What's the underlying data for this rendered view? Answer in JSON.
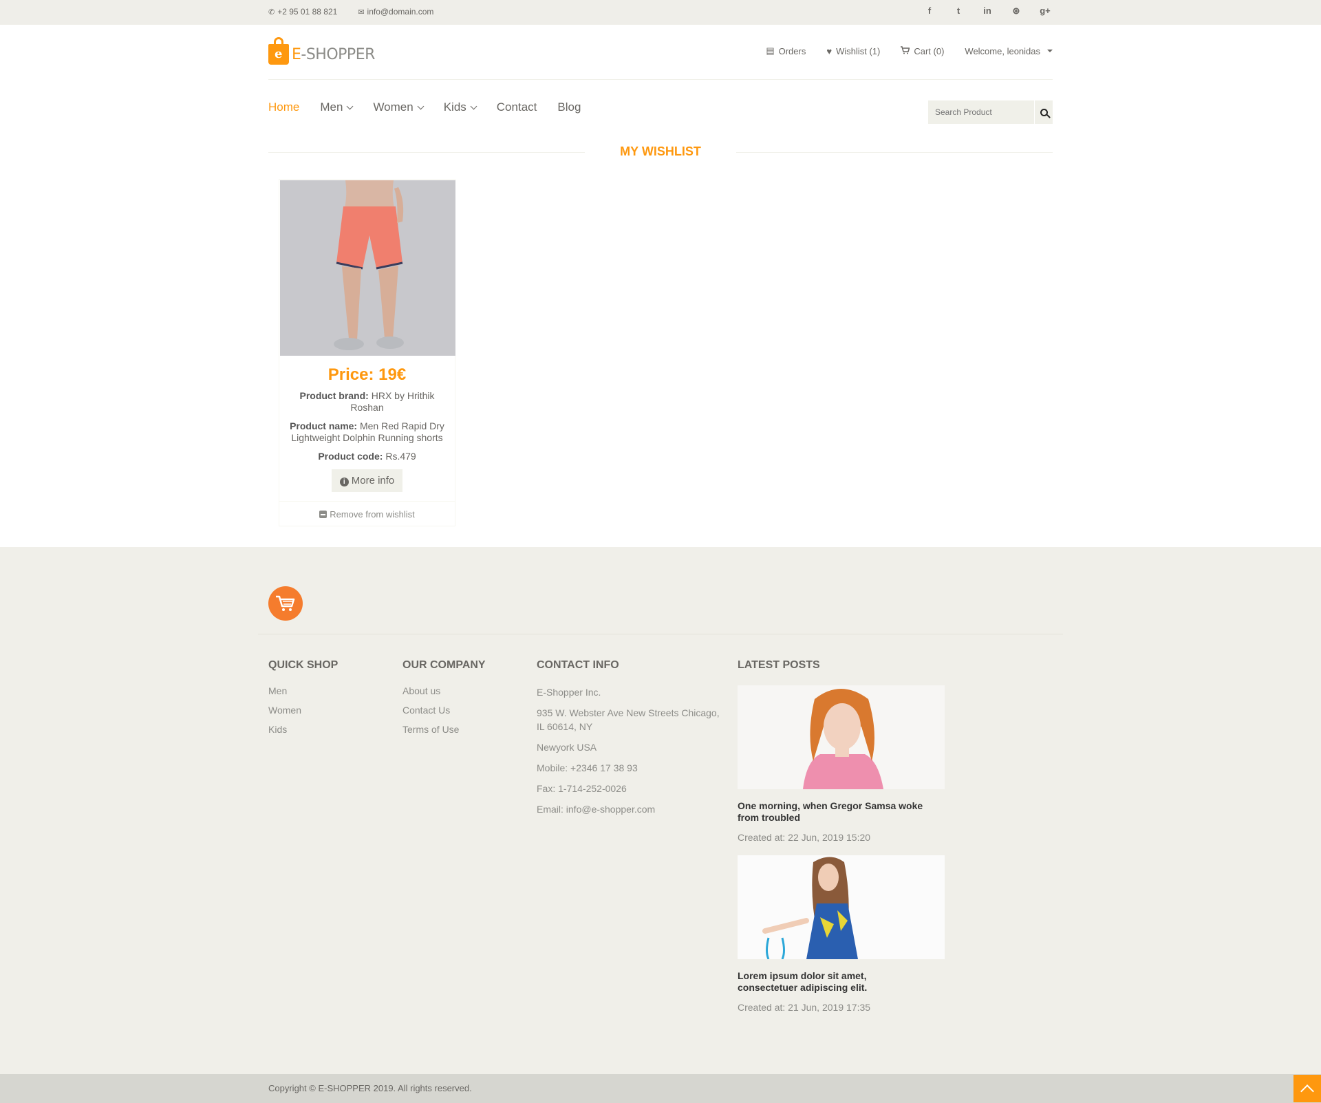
{
  "topbar": {
    "phone": "+2 95 01 88 821",
    "email": "info@domain.com",
    "social": [
      "f",
      "t",
      "in",
      "⊛",
      "g+"
    ]
  },
  "logo": {
    "prefix": "E",
    "text": "-SHOPPER",
    "bag_letter": "e"
  },
  "shop_menu": {
    "orders": "Orders",
    "wishlist": "Wishlist (1)",
    "cart": "Cart (0)",
    "welcome": "Welcome, leonidas"
  },
  "nav": {
    "home": "Home",
    "men": "Men",
    "women": "Women",
    "kids": "Kids",
    "contact": "Contact",
    "blog": "Blog"
  },
  "search": {
    "placeholder": "Search Product"
  },
  "page_title": "MY WISHLIST",
  "product": {
    "price": "Price: 19€",
    "brand_label": "Product brand:",
    "brand": "HRX by Hrithik Roshan",
    "name_label": "Product name:",
    "name": "Men Red Rapid Dry Lightweight Dolphin Running shorts",
    "code_label": "Product code:",
    "code": "Rs.479",
    "more_info": "More info",
    "remove": "Remove from wishlist"
  },
  "footer": {
    "quick_shop": {
      "title": "QUICK SHOP",
      "links": [
        "Men",
        "Women",
        "Kids"
      ]
    },
    "company": {
      "title": "OUR COMPANY",
      "links": [
        "About us",
        "Contact Us",
        "Terms of Use"
      ]
    },
    "contact": {
      "title": "CONTACT INFO",
      "lines": [
        "E-Shopper Inc.",
        "935 W. Webster Ave New Streets Chicago, IL 60614, NY",
        "Newyork USA",
        "Mobile: +2346 17 38 93",
        "Fax: 1-714-252-0026",
        "Email: info@e-shopper.com"
      ]
    },
    "posts": {
      "title": "LATEST POSTS",
      "items": [
        {
          "title": "One morning, when Gregor Samsa woke from troubled",
          "date": "Created at: 22 Jun, 2019 15:20"
        },
        {
          "title": "Lorem ipsum dolor sit amet, consectetuer adipiscing elit.",
          "date": "Created at: 21 Jun, 2019 17:35"
        }
      ]
    }
  },
  "copyright": "Copyright © E-SHOPPER 2019. All rights reserved.",
  "colors": {
    "accent": "#fe980f",
    "footer_bg": "#f0efe9",
    "cart_circle": "#f57c2d"
  }
}
